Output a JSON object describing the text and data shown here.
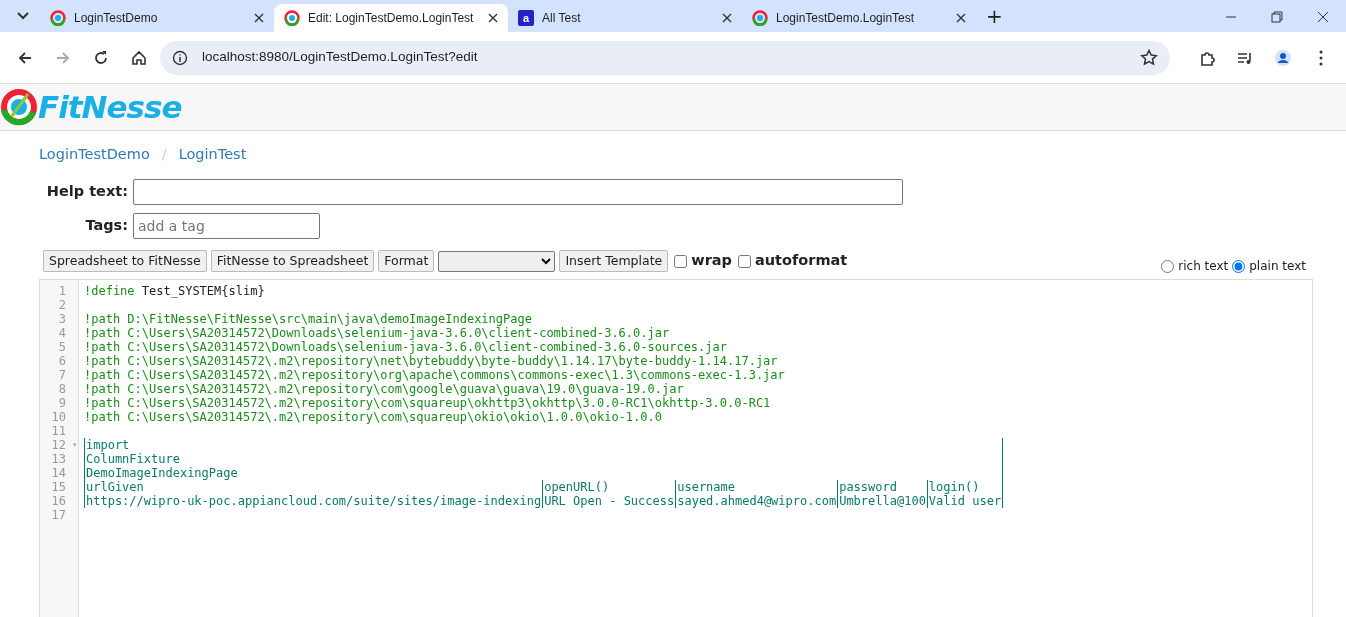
{
  "browser": {
    "tabs": [
      {
        "title": "LoginTestDemo",
        "kind": "site",
        "selected": false
      },
      {
        "title": "Edit: LoginTestDemo.LoginTest",
        "kind": "site",
        "selected": true
      },
      {
        "title": "All Test",
        "kind": "letter",
        "icon_text": "a",
        "selected": false
      },
      {
        "title": "LoginTestDemo.LoginTest",
        "kind": "site",
        "selected": false
      }
    ],
    "new_tab": "+",
    "address": "localhost:8980/LoginTestDemo.LoginTest?edit"
  },
  "logo": "FitNesse",
  "breadcrumbs": [
    {
      "label": "LoginTestDemo"
    },
    {
      "label": "LoginTest"
    }
  ],
  "breadcrumb_separator": "/",
  "help_text": {
    "label": "Help text:"
  },
  "tags": {
    "label": "Tags:",
    "placeholder": "add a tag"
  },
  "toolbar": {
    "buttons": [
      {
        "label": "Spreadsheet to FitNesse",
        "kind": "button"
      },
      {
        "label": "FitNesse to Spreadsheet",
        "kind": "button"
      },
      {
        "label": "Format",
        "kind": "button"
      },
      {
        "kind": "select"
      },
      {
        "label": "Insert Template",
        "kind": "button"
      }
    ],
    "checkboxes": [
      {
        "label": "wrap",
        "checked": false
      },
      {
        "label": "autoformat",
        "checked": false
      }
    ],
    "modes": [
      {
        "label": "rich text",
        "selected": false
      },
      {
        "label": "plain text",
        "selected": true
      }
    ]
  },
  "editor": {
    "lines": [
      {
        "number": "1",
        "kind": "code",
        "segments": [
          {
            "text": "!define",
            "kind": "keyword"
          },
          {
            "text": " Test_SYSTEM{slim}",
            "kind": "plain"
          }
        ]
      },
      {
        "number": "2",
        "kind": "blank"
      },
      {
        "number": "3",
        "kind": "code",
        "segments": [
          {
            "text": "!path D:\\FitNesse\\FitNesse\\src\\main\\java\\demoImageIndexingPage",
            "kind": "keyword"
          }
        ]
      },
      {
        "number": "4",
        "kind": "code",
        "segments": [
          {
            "text": "!path C:\\Users\\SA20314572\\Downloads\\selenium-java-3.6.0\\client-combined-3.6.0.jar",
            "kind": "keyword"
          }
        ]
      },
      {
        "number": "5",
        "kind": "code",
        "segments": [
          {
            "text": "!path C:\\Users\\SA20314572\\Downloads\\selenium-java-3.6.0\\client-combined-3.6.0-sources.jar",
            "kind": "keyword"
          }
        ]
      },
      {
        "number": "6",
        "kind": "code",
        "segments": [
          {
            "text": "!path C:\\Users\\SA20314572\\.m2\\repository\\net\\bytebuddy\\byte-buddy\\1.14.17\\byte-buddy-1.14.17.jar",
            "kind": "keyword"
          }
        ]
      },
      {
        "number": "7",
        "kind": "code",
        "segments": [
          {
            "text": "!path C:\\Users\\SA20314572\\.m2\\repository\\org\\apache\\commons\\commons-exec\\1.3\\commons-exec-1.3.jar",
            "kind": "keyword"
          }
        ]
      },
      {
        "number": "8",
        "kind": "code",
        "segments": [
          {
            "text": "!path C:\\Users\\SA20314572\\.m2\\repository\\com\\google\\guava\\guava\\19.0\\guava-19.0.jar",
            "kind": "keyword"
          }
        ]
      },
      {
        "number": "9",
        "kind": "code",
        "segments": [
          {
            "text": "!path C:\\Users\\SA20314572\\.m2\\repository\\com\\squareup\\okhttp3\\okhttp\\3.0.0-RC1\\okhttp-3.0.0-RC1",
            "kind": "keyword"
          }
        ]
      },
      {
        "number": "10",
        "kind": "code",
        "segments": [
          {
            "text": "!path C:\\Users\\SA20314572\\.m2\\repository\\com\\squareup\\okio\\okio\\1.0.0\\okio-1.0.0",
            "kind": "keyword"
          }
        ]
      },
      {
        "number": "11",
        "kind": "blank"
      },
      {
        "number": "12",
        "kind": "table",
        "fold": "▾",
        "cells": [
          "import"
        ]
      },
      {
        "number": "13",
        "kind": "table",
        "cells": [
          "ColumnFixture"
        ]
      },
      {
        "number": "14",
        "kind": "table",
        "cells": [
          "DemoImageIndexingPage"
        ]
      },
      {
        "number": "15",
        "kind": "table",
        "cells": [
          "urlGiven",
          "openURL()",
          "username",
          "password",
          "login()"
        ]
      },
      {
        "number": "16",
        "kind": "table",
        "cells": [
          "https://wipro-uk-poc.appiancloud.com/suite/sites/image-indexing",
          "URL Open - Success",
          "sayed.ahmed4@wipro.com",
          "Umbrella@100",
          "Valid user"
        ]
      },
      {
        "number": "17",
        "kind": "blank"
      }
    ]
  }
}
